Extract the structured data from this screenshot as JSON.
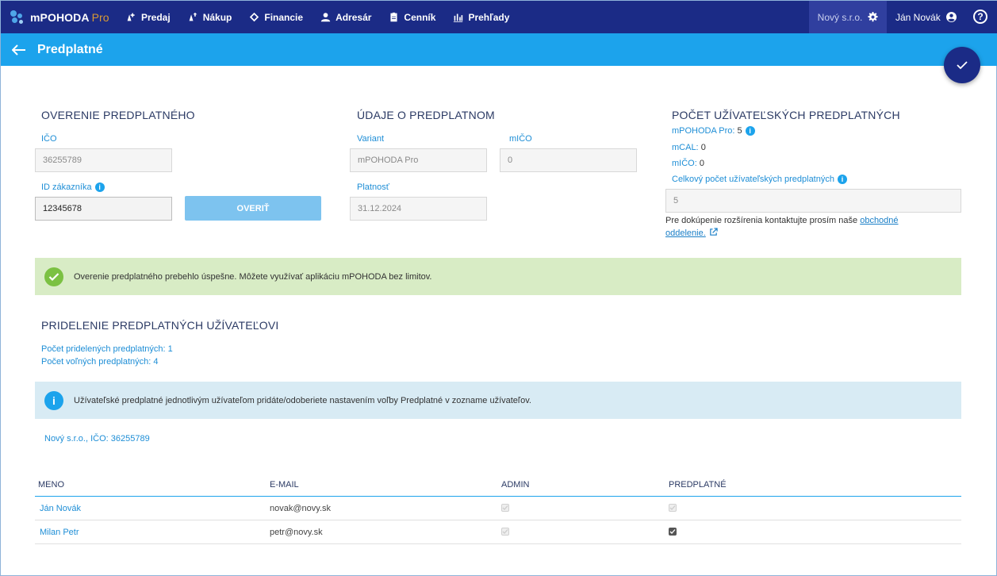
{
  "app": {
    "brand": "mPOHODA",
    "brand_suffix": "Pro"
  },
  "nav": [
    {
      "label": "Predaj",
      "icon": "sales-icon"
    },
    {
      "label": "Nákup",
      "icon": "purchase-icon"
    },
    {
      "label": "Financie",
      "icon": "finance-icon"
    },
    {
      "label": "Adresár",
      "icon": "person-icon"
    },
    {
      "label": "Cenník",
      "icon": "pricelist-icon"
    },
    {
      "label": "Prehľady",
      "icon": "chart-icon"
    }
  ],
  "header": {
    "company": "Nový s.r.o.",
    "user": "Ján Novák",
    "help": "?"
  },
  "page": {
    "title": "Predplatné"
  },
  "verification": {
    "heading": "OVERENIE PREDPLATNÉHO",
    "ico_label": "IČO",
    "ico_value": "36255789",
    "customer_id_label": "ID zákazníka",
    "customer_id_value": "12345678",
    "verify_button": "OVERIŤ"
  },
  "subscription": {
    "heading": "ÚDAJE O PREDPLATNOM",
    "variant_label": "Variant",
    "variant_value": "mPOHODA Pro",
    "mico_label": "mIČO",
    "mico_value": "0",
    "validity_label": "Platnosť",
    "validity_value": "31.12.2024"
  },
  "user_count": {
    "heading": "POČET UŽÍVATEĽSKÝCH PREDPLATNÝCH",
    "pro_label": "mPOHODA Pro:",
    "pro_value": "5",
    "mcal_label": "mCAL:",
    "mcal_value": "0",
    "mico_label": "mIČO:",
    "mico_value": "0",
    "total_label": "Celkový počet užívateľských predplatných",
    "total_value": "5",
    "contact_text": "Pre dokúpenie rozšírenia kontaktujte prosím naše",
    "contact_link_1": "obchodné",
    "contact_link_2": "oddelenie."
  },
  "success_message": "Overenie predplatného prebehlo úspešne. Môžete využívať aplikáciu mPOHODA bez limitov.",
  "assignment": {
    "heading": "PRIDELENIE PREDPLATNÝCH UŽÍVATEĽOVI",
    "assigned": "Počet pridelených predplatných: 1",
    "free": "Počet voľných predplatných: 4",
    "info": "Užívateľské predplatné jednotlivým užívateľom pridáte/odoberiete nastavením voľby Predplatné v zozname užívateľov.",
    "company_line": "Nový s.r.o., IČO: 36255789"
  },
  "table": {
    "columns": [
      "MENO",
      "E-MAIL",
      "ADMIN",
      "PREDPLATNÉ"
    ],
    "rows": [
      {
        "name": "Ján Novák",
        "email": "novak@novy.sk",
        "admin": true,
        "subscription": true
      },
      {
        "name": "Milan Petr",
        "email": "petr@novy.sk",
        "admin": true,
        "subscription": true
      }
    ]
  },
  "colors": {
    "topbar": "#1b2b86",
    "subbar": "#1ca3ec",
    "success": "#d8ecc5",
    "info": "#d8ebf4"
  }
}
